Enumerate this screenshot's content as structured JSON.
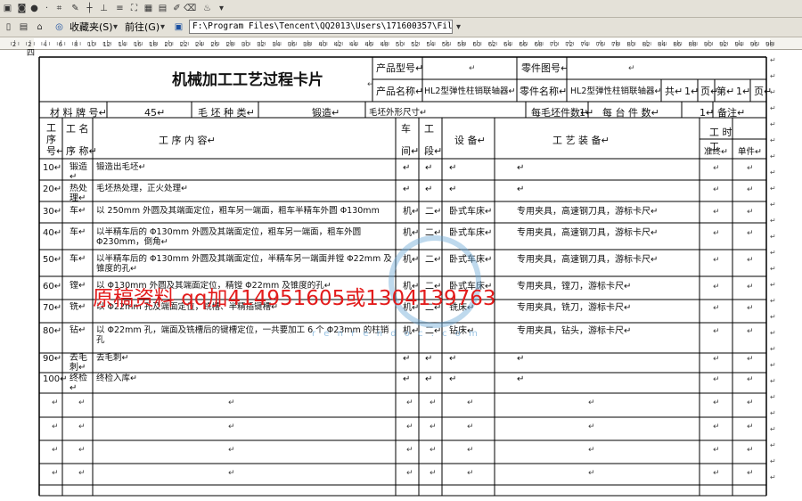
{
  "toolbar": {
    "favorites_label": "收藏夹(S)",
    "go_label": "前往(G)",
    "address_value": "F:\\Program Files\\Tencent\\QQ2013\\Users\\171600357\\FileRecv"
  },
  "ruler": {
    "labels": [
      "2",
      "2",
      "4",
      "6",
      "8",
      "10",
      "12",
      "14",
      "16",
      "18",
      "20",
      "22",
      "24",
      "26",
      "28",
      "30",
      "32",
      "34",
      "36",
      "38",
      "40",
      "42",
      "44",
      "46",
      "48",
      "50",
      "52",
      "54",
      "56",
      "58",
      "60",
      "62",
      "64",
      "66",
      "68",
      "70",
      "72",
      "74",
      "76",
      "78",
      "80",
      "82",
      "84",
      "86",
      "88",
      "90",
      "92",
      "94",
      "96",
      "98"
    ]
  },
  "doc": {
    "corner_label": "四",
    "title": "机械加工工艺过程卡片",
    "mark": "↵",
    "product_model_label": "产品型号↵",
    "part_no_label": "零件图号↵",
    "product_name_label": "产品名称↵",
    "product_name_value": "HL2型弹性柱销联轴器↵",
    "part_name_label": "零件名称↵",
    "part_name_value": "HL2型弹性柱销联轴器↵",
    "total_label": "共↵",
    "total_value": "1↵",
    "page_label": "页↵",
    "no_label": "第↵",
    "no_value": "1↵",
    "page_label2": "页↵",
    "material_label": "材 料 牌 号↵",
    "material_value": "45↵",
    "blank_type_label": "毛 坯 种 类↵",
    "blank_type_value": "锻造↵",
    "blank_size_label": "毛坯外形尺寸↵",
    "per_blank_label": "每毛坯件数↵",
    "per_blank_value": "1↵",
    "per_unit_label": "每 台 件 数↵",
    "per_unit_value": "1↵",
    "remark_label": "备注↵",
    "hdr": {
      "seq1": "工",
      "seq2": "序",
      "seq3": "号↵",
      "name1": "工 名",
      "name2": "序 称↵",
      "content": "工         序         内         容↵",
      "workshop1": "车",
      "workshop2": "间↵",
      "section1": "工",
      "section2": "段↵",
      "equipment": "设  备↵",
      "tooling": "工     艺     装     备↵",
      "time": "工      时",
      "prep1": "工",
      "prep2": "准终↵",
      "unit": "单件↵"
    },
    "rows": [
      {
        "no": "10↵",
        "name": "锻造↵",
        "content": "锻造出毛坯↵",
        "ws": "↵",
        "sec": "↵",
        "equip": "↵",
        "tool": "↵"
      },
      {
        "no": "20↵",
        "name": "热处理↵",
        "content": "毛坯热处理，正火处理↵",
        "ws": "↵",
        "sec": "↵",
        "equip": "↵",
        "tool": "↵"
      },
      {
        "no": "30↵",
        "name": "车↵",
        "content": "以 250mm 外圆及其端面定位，粗车另一端面，粗车半精车外圆 Φ130mm",
        "ws": "机↵",
        "sec": "二↵",
        "equip": "卧式车床↵",
        "tool": "专用夹具，高速钢刀具，游标卡尺↵"
      },
      {
        "no": "40↵",
        "name": "车↵",
        "content": "以半精车后的 Φ130mm 外圆及其端面定位，粗车另一端面，粗车外圆 Φ230mm，倒角↵",
        "ws": "机↵",
        "sec": "二↵",
        "equip": "卧式车床↵",
        "tool": "专用夹具，高速钢刀具，游标卡尺↵"
      },
      {
        "no": "50↵",
        "name": "车↵",
        "content": "以半精车后的 Φ130mm 外圆及其端面定位，半精车另一端面并镗 Φ22mm 及锥度的孔↵",
        "ws": "机↵",
        "sec": "二↵",
        "equip": "卧式车床↵",
        "tool": "专用夹具，高速钢刀具，游标卡尺↵"
      },
      {
        "no": "60↵",
        "name": "镗↵",
        "content": "以 Φ130mm 外圆及其端面定位，精镗 Φ22mm 及锥度的孔↵",
        "ws": "机↵",
        "sec": "二↵",
        "equip": "卧式车床↵",
        "tool": "专用夹具，镗刀，游标卡尺↵"
      },
      {
        "no": "70↵",
        "name": "铣↵",
        "content": "以 Φ22mm 孔及端面定位，铣槽、半精插键槽↵",
        "ws": "机↵",
        "sec": "二↵",
        "equip": "铣床↵",
        "tool": "专用夹具，铣刀，游标卡尺↵"
      },
      {
        "no": "80↵",
        "name": "钻↵",
        "content": "以 Φ22mm 孔，端面及铣槽后的键槽定位，一共要加工 6 个 Φ23mm 的柱销孔",
        "ws": "机↵",
        "sec": "二↵",
        "equip": "钻床↵",
        "tool": "专用夹具，钻头，游标卡尺↵"
      },
      {
        "no": "90↵",
        "name": "去毛刺↵",
        "content": "去毛刺↵",
        "ws": "↵",
        "sec": "↵",
        "equip": "↵",
        "tool": "↵"
      },
      {
        "no": "100↵",
        "name": "终检↵",
        "content": "终检入库↵",
        "ws": "↵",
        "sec": "↵",
        "equip": "↵",
        "tool": "↵"
      }
    ],
    "watermark": "原稿资料 qq加414951605或1304139763",
    "watermark_url": "r e n r e n d o c . c o m"
  }
}
